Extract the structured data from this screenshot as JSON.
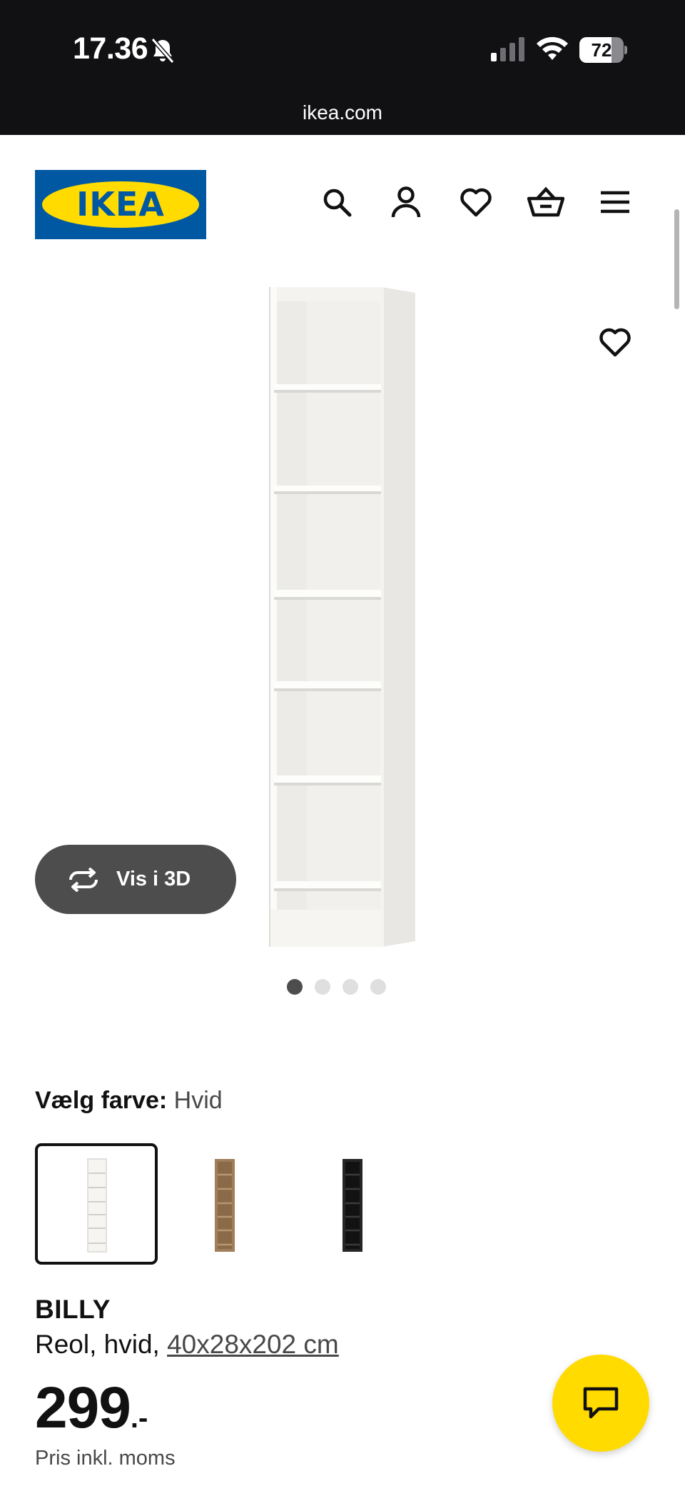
{
  "status_bar": {
    "time": "17.36",
    "battery_level": "72",
    "battery_fraction": 0.72,
    "icons": [
      "bell-muted-icon",
      "cellular-signal-icon",
      "wifi-icon",
      "battery-icon"
    ]
  },
  "browser": {
    "url": "ikea.com"
  },
  "header": {
    "logo_text": "IKEA",
    "icons": [
      "search-icon",
      "account-icon",
      "heart-icon",
      "basket-icon",
      "menu-icon"
    ]
  },
  "gallery": {
    "view_3d_label": "Vis i 3D",
    "icons": [
      "rotate-3d-icon",
      "heart-icon"
    ],
    "dots_count": 4,
    "active_dot": 0
  },
  "color_selector": {
    "label": "Vælg farve:",
    "selected_value": "Hvid",
    "options": [
      {
        "name": "Hvid",
        "color": "#f2f1ee",
        "selected": true
      },
      {
        "name": "Egetræsmønster",
        "color": "#9b7a55",
        "selected": false
      },
      {
        "name": "Sort",
        "color": "#232323",
        "selected": false
      }
    ]
  },
  "product": {
    "name": "BILLY",
    "description": "Reol, hvid, ",
    "dimensions": "40x28x202 cm",
    "price": "299",
    "price_suffix": ".-",
    "price_note": "Pris inkl. moms"
  },
  "chat": {
    "icon": "chat-icon"
  },
  "colors": {
    "ikea_blue": "#0058a3",
    "ikea_yellow": "#ffdb00",
    "status_bar_bg": "#111114",
    "button_dark": "#4d4d4d"
  }
}
